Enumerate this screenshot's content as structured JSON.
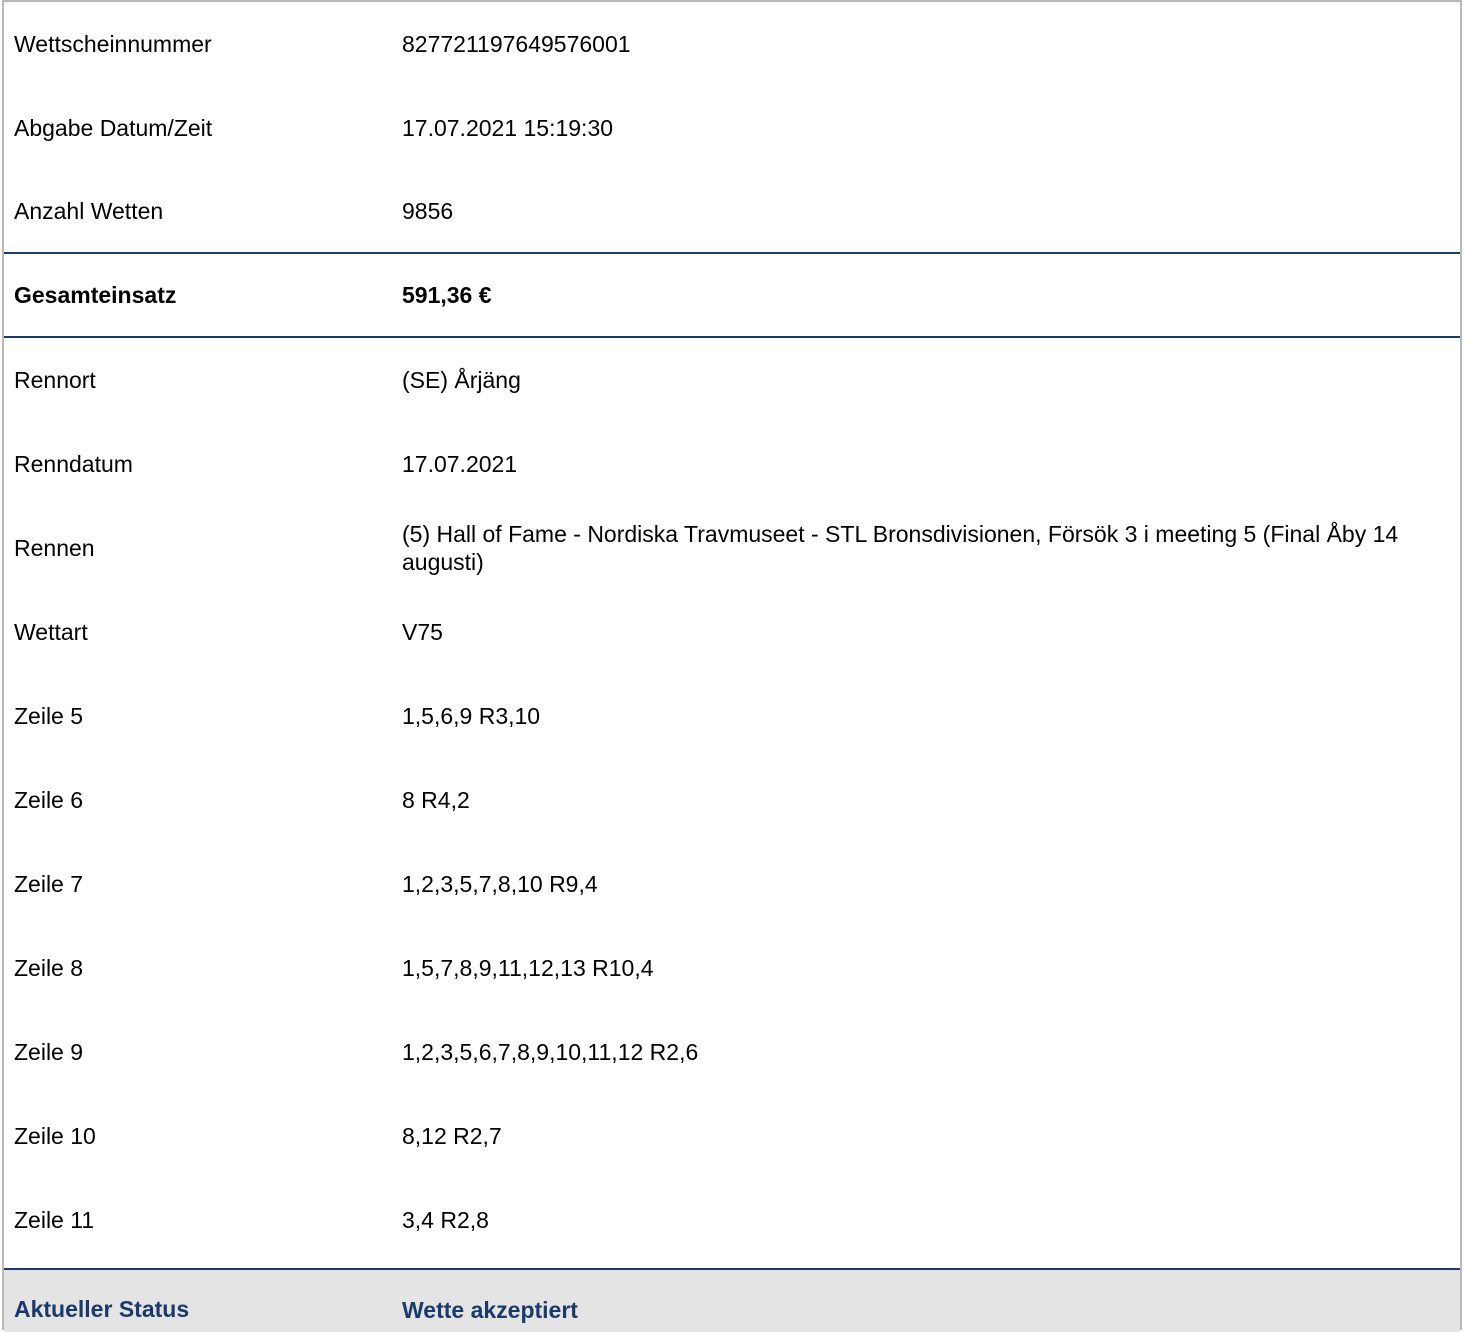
{
  "ticket": {
    "number_label": "Wettscheinnummer",
    "number_value": "827721197649576001",
    "date_label": "Abgabe Datum/Zeit",
    "date_value": "17.07.2021 15:19:30",
    "count_label": "Anzahl Wetten",
    "count_value": "9856"
  },
  "stake": {
    "label": "Gesamteinsatz",
    "value": "591,36 €"
  },
  "race": {
    "venue_label": "Rennort",
    "venue_value": "(SE) Årjäng",
    "date_label": "Renndatum",
    "date_value": "17.07.2021",
    "race_label": "Rennen",
    "race_value": "(5) Hall of Fame - Nordiska Travmuseet - STL Bronsdivisionen, Försök 3 i meeting 5 (Final Åby 14 augusti)",
    "bet_type_label": "Wettart",
    "bet_type_value": "V75"
  },
  "lines": [
    {
      "label": "Zeile 5",
      "value": "1,5,6,9 R3,10"
    },
    {
      "label": "Zeile 6",
      "value": "8 R4,2"
    },
    {
      "label": "Zeile 7",
      "value": "1,2,3,5,7,8,10 R9,4"
    },
    {
      "label": "Zeile 8",
      "value": "1,5,7,8,9,11,12,13 R10,4"
    },
    {
      "label": "Zeile 9",
      "value": "1,2,3,5,6,7,8,9,10,11,12 R2,6"
    },
    {
      "label": "Zeile 10",
      "value": "8,12 R2,7"
    },
    {
      "label": "Zeile 11",
      "value": "3,4 R2,8"
    }
  ],
  "status": {
    "label": "Aktueller Status",
    "value": "Wette akzeptiert"
  },
  "colors": {
    "accent": "#1a3a6b",
    "status_bg": "#e4e4e4",
    "border": "#b8b8b8"
  }
}
